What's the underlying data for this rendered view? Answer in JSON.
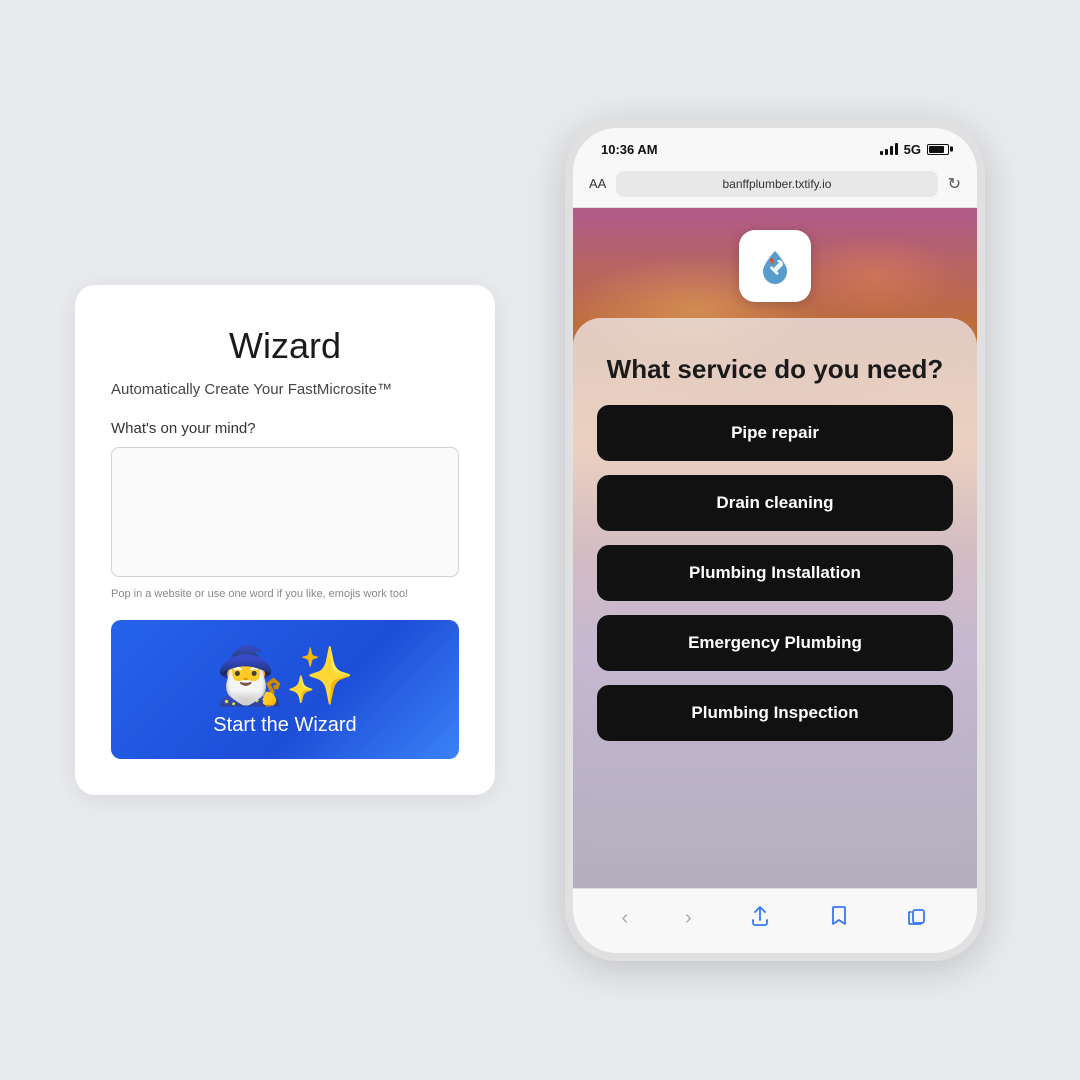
{
  "background": "#e8eaed",
  "wizard": {
    "title": "Wizard",
    "subtitle": "Automatically Create Your FastMicrosite™",
    "label": "What's on your mind?",
    "textarea_placeholder": "",
    "hint": "Pop in a website or use one word if you like, emojis work too!",
    "button_label": "Start the Wizard",
    "button_icon": "🧙‍♂️"
  },
  "phone": {
    "status_time": "10:36 AM",
    "status_signal": "5G",
    "browser_aa": "AA",
    "browser_url": "banffplumber.txtify.io",
    "logo_icon": "🔧",
    "question": "What service do you need?",
    "services": [
      "Pipe repair",
      "Drain cleaning",
      "Plumbing Installation",
      "Emergency Plumbing",
      "Plumbing Inspection"
    ]
  }
}
